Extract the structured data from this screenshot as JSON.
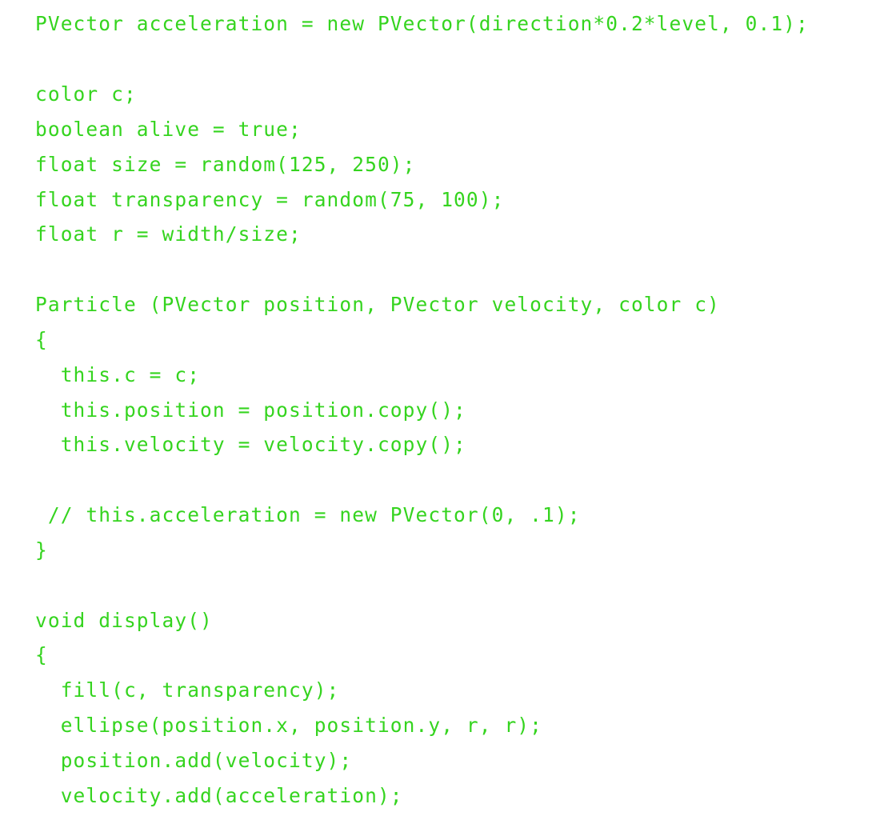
{
  "theme": {
    "text_color": "#35d41f",
    "background": "#ffffff"
  },
  "code": {
    "lines": [
      "PVector acceleration = new PVector(direction*0.2*level, 0.1);",
      "",
      "color c;",
      "boolean alive = true;",
      "float size = random(125, 250);",
      "float transparency = random(75, 100);",
      "float r = width/size;",
      "",
      "Particle (PVector position, PVector velocity, color c)",
      "{",
      "  this.c = c;",
      "  this.position = position.copy();",
      "  this.velocity = velocity.copy();",
      "",
      " // this.acceleration = new PVector(0, .1);",
      "}",
      "",
      "void display()",
      "{",
      "  fill(c, transparency);",
      "  ellipse(position.x, position.y, r, r);",
      "  position.add(velocity);",
      "  velocity.add(acceleration);"
    ]
  }
}
